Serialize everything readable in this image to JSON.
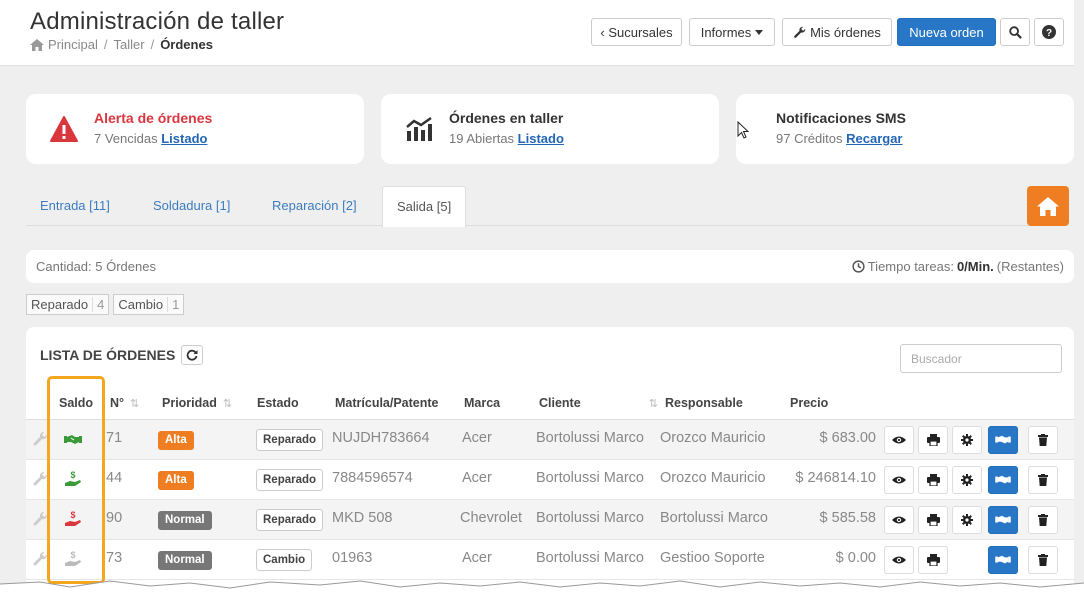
{
  "header": {
    "title": "Administración de taller",
    "breadcrumb": {
      "home": "Principal",
      "section": "Taller",
      "current": "Órdenes",
      "separator": "/"
    },
    "buttons": {
      "sucursales": "‹ Sucursales",
      "informes": "Informes",
      "mis_ordenes": "Mis órdenes",
      "nueva_orden": "Nueva orden"
    }
  },
  "cards": [
    {
      "title": "Alerta de órdenes",
      "prefix": "7 Vencidas",
      "link": "Listado",
      "icon": "warning-icon",
      "color": "#d9363e"
    },
    {
      "title": "Órdenes en taller",
      "prefix": "19 Abiertas",
      "link": "Listado",
      "icon": "chart-icon",
      "color": "#333333"
    },
    {
      "title": "Notificaciones SMS",
      "prefix": "97 Créditos",
      "link": "Recargar",
      "icon": "",
      "color": "#333333"
    }
  ],
  "tabs": [
    {
      "label": "Entrada [11]",
      "active": false
    },
    {
      "label": "Soldadura [1]",
      "active": false
    },
    {
      "label": "Reparación [2]",
      "active": false
    },
    {
      "label": "Salida [5]",
      "active": true
    }
  ],
  "countbar": {
    "cantidad": "Cantidad: 5 Órdenes",
    "tiempo_label": "Tiempo tareas:",
    "tiempo_value": "0/Min.",
    "tiempo_suffix": "(Restantes)"
  },
  "tags": [
    {
      "label": "Reparado",
      "count": "4"
    },
    {
      "label": "Cambio",
      "count": "1"
    }
  ],
  "table": {
    "title": "LISTA DE ÓRDENES",
    "search_placeholder": "Buscador",
    "columns": {
      "saldo": "Saldo",
      "numero": "N°",
      "prioridad": "Prioridad",
      "estado": "Estado",
      "matricula": "Matrícula/Patente",
      "marca": "Marca",
      "cliente": "Cliente",
      "responsable": "Responsable",
      "precio": "Precio"
    },
    "rows": [
      {
        "saldo_icon": "handshake-icon",
        "saldo_color": "#3a9a3a",
        "numero": "71",
        "prioridad": "Alta",
        "estado": "Reparado",
        "matricula": "NUJDH783664",
        "marca": "Acer",
        "cliente": "Bortolussi Marco",
        "responsable": "Orozco Mauricio",
        "precio": "$ 683.00"
      },
      {
        "saldo_icon": "hand-money-icon",
        "saldo_color": "#3a9a3a",
        "numero": "44",
        "prioridad": "Alta",
        "estado": "Reparado",
        "matricula": "7884596574",
        "marca": "Acer",
        "cliente": "Bortolussi Marco",
        "responsable": "Orozco Mauricio",
        "precio": "$ 246814.10"
      },
      {
        "saldo_icon": "hand-money-icon",
        "saldo_color": "#d9363e",
        "numero": "90",
        "prioridad": "Normal",
        "estado": "Reparado",
        "matricula": "MKD 508",
        "marca": "Chevrolet",
        "cliente": "Bortolussi Marco",
        "responsable": "Bortolussi Marco",
        "precio": "$ 585.58"
      },
      {
        "saldo_icon": "hand-money-icon",
        "saldo_color": "#bbbbbb",
        "numero": "73",
        "prioridad": "Normal",
        "estado": "Cambio",
        "matricula": "01963",
        "marca": "Acer",
        "cliente": "Bortolussi Marco",
        "responsable": "Gestioo Soporte",
        "precio": "$ 0.00"
      }
    ]
  },
  "colors": {
    "primary": "#2777c6",
    "orange": "#ef7d22",
    "alert": "#d9363e",
    "highlight": "#f2a71e"
  }
}
